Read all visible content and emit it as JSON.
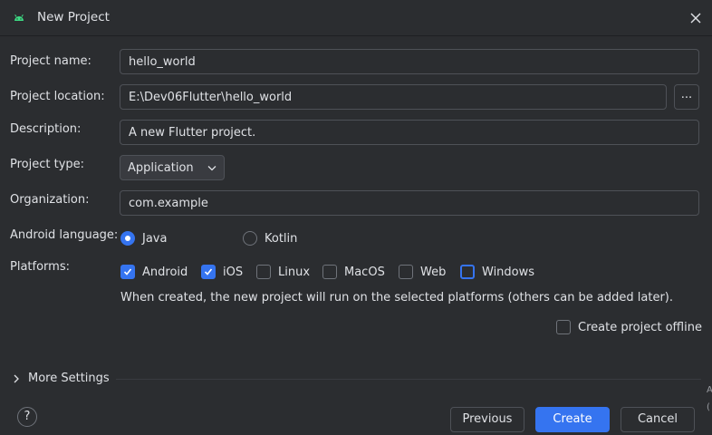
{
  "window": {
    "title": "New Project",
    "app_icon": "android-icon",
    "close_icon": "close-icon"
  },
  "form": {
    "project_name": {
      "label": "Project name:",
      "value": "hello_world"
    },
    "project_location": {
      "label": "Project location:",
      "value": "E:\\Dev06Flutter\\hello_world",
      "browse_label": "..."
    },
    "description": {
      "label": "Description:",
      "value": "A new Flutter project."
    },
    "project_type": {
      "label": "Project type:",
      "selected": "Application"
    },
    "organization": {
      "label": "Organization:",
      "value": "com.example"
    },
    "android_language": {
      "label": "Android language:",
      "options": [
        {
          "label": "Java",
          "selected": true
        },
        {
          "label": "Kotlin",
          "selected": false
        }
      ]
    },
    "platforms": {
      "label": "Platforms:",
      "options": [
        {
          "label": "Android",
          "checked": true
        },
        {
          "label": "iOS",
          "checked": true
        },
        {
          "label": "Linux",
          "checked": false
        },
        {
          "label": "MacOS",
          "checked": false
        },
        {
          "label": "Web",
          "checked": false
        },
        {
          "label": "Windows",
          "checked": false
        }
      ],
      "hint": "When created, the new project will run on the selected platforms (others can be added later)."
    },
    "offline": {
      "label": "Create project offline",
      "checked": false
    },
    "more_settings": "More Settings"
  },
  "footer": {
    "help_label": "?",
    "previous_label": "Previous",
    "create_label": "Create",
    "cancel_label": "Cancel"
  },
  "edge_glyphs": [
    "A",
    "("
  ],
  "colors": {
    "background": "#2b2d30",
    "accent": "#3574f0",
    "border": "#4e5157",
    "text": "#dfe1e5"
  }
}
